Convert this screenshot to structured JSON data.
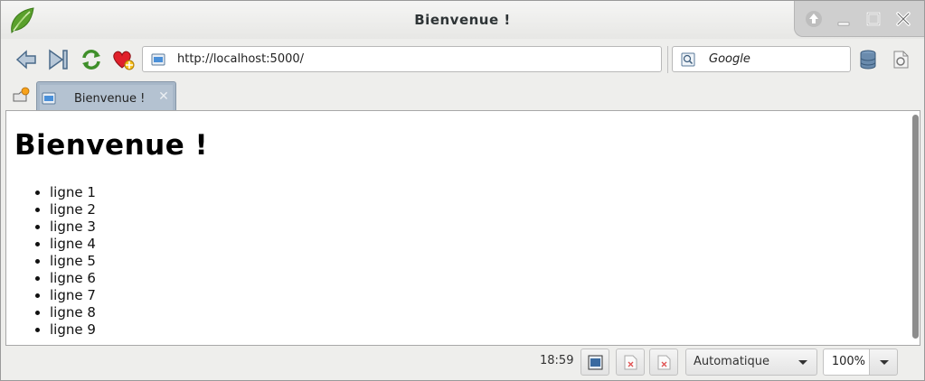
{
  "window": {
    "title": "Bienvenue !"
  },
  "navigation": {
    "url": "http://localhost:5000/",
    "search_engine": "Google"
  },
  "tabs": [
    {
      "label": "Bienvenue !"
    }
  ],
  "page": {
    "heading": "Bienvenue !",
    "items": [
      "ligne 1",
      "ligne 2",
      "ligne 3",
      "ligne 4",
      "ligne 5",
      "ligne 6",
      "ligne 7",
      "ligne 8",
      "ligne 9"
    ]
  },
  "status": {
    "time": "18:59",
    "encoding": "Automatique",
    "zoom": "100%"
  },
  "icons": {
    "app": "midori-leaf-icon",
    "back": "back-arrow-icon",
    "forward": "skip-forward-icon",
    "reload": "reload-icon",
    "bookmark": "heart-bookmark-icon"
  },
  "colors": {
    "tab_active": "#b4c2d1",
    "leaf_green": "#5aa02c"
  }
}
